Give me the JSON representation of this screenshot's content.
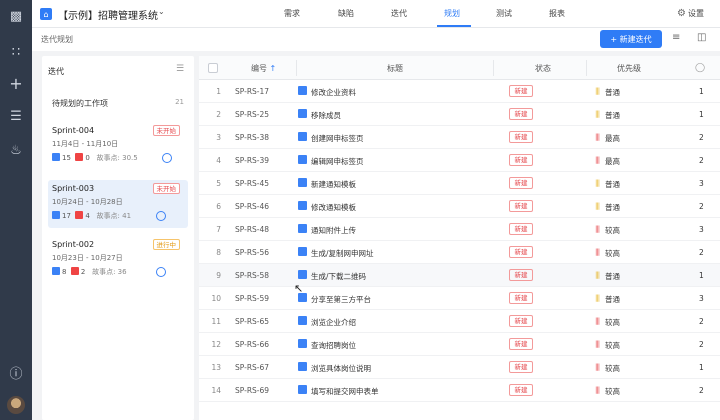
{
  "rail": {
    "icons": [
      "logo-icon",
      "apps-grid-icon",
      "plus-icon",
      "checklist-icon",
      "bell-icon",
      "help-icon"
    ]
  },
  "topbar": {
    "project": "【示例】招聘管理系统",
    "tabs": [
      "需求",
      "缺陷",
      "迭代",
      "规划",
      "测试",
      "报表"
    ],
    "active_tab": "规划",
    "settings": "设置"
  },
  "subbar": {
    "breadcrumb": "迭代规划",
    "new_button": "+ 新建迭代"
  },
  "left_panel": {
    "title": "迭代",
    "backlog": {
      "label": "待规划的工作项",
      "count": "21"
    },
    "sprints": [
      {
        "name": "Sprint-004",
        "dates": "11月4日 - 11月10日",
        "status": "未开始",
        "reqs": "15",
        "bugs": "0",
        "points": "故事点: 30.5"
      },
      {
        "name": "Sprint-003",
        "dates": "10月24日 - 10月28日",
        "status": "未开始",
        "reqs": "17",
        "bugs": "4",
        "points": "故事点: 41"
      },
      {
        "name": "Sprint-002",
        "dates": "10月23日 - 10月27日",
        "status": "进行中",
        "reqs": "8",
        "bugs": "2",
        "points": "故事点: 36"
      }
    ]
  },
  "table": {
    "headers": {
      "code": "编号",
      "title": "标题",
      "status": "状态",
      "priority": "优先级"
    },
    "rows": [
      {
        "n": "1",
        "code": "SP-RS-17",
        "title": "修改企业资料",
        "status": "新建",
        "priority": "普通",
        "pcolor": "#e6b422",
        "count": "1"
      },
      {
        "n": "2",
        "code": "SP-RS-25",
        "title": "移除成员",
        "status": "新建",
        "priority": "普通",
        "pcolor": "#e6b422",
        "count": "1"
      },
      {
        "n": "3",
        "code": "SP-RS-38",
        "title": "创建网申标签页",
        "status": "新建",
        "priority": "最高",
        "pcolor": "#e5484d",
        "count": "2"
      },
      {
        "n": "4",
        "code": "SP-RS-39",
        "title": "编辑网申标签页",
        "status": "新建",
        "priority": "最高",
        "pcolor": "#e5484d",
        "count": "2"
      },
      {
        "n": "5",
        "code": "SP-RS-45",
        "title": "新建通知模板",
        "status": "新建",
        "priority": "普通",
        "pcolor": "#e6b422",
        "count": "3"
      },
      {
        "n": "6",
        "code": "SP-RS-46",
        "title": "修改通知模板",
        "status": "新建",
        "priority": "普通",
        "pcolor": "#e6b422",
        "count": "2"
      },
      {
        "n": "7",
        "code": "SP-RS-48",
        "title": "通知附件上传",
        "status": "新建",
        "priority": "较高",
        "pcolor": "#e5484d",
        "count": "3"
      },
      {
        "n": "8",
        "code": "SP-RS-56",
        "title": "生成/复制网申网址",
        "status": "新建",
        "priority": "较高",
        "pcolor": "#e5484d",
        "count": "2"
      },
      {
        "n": "9",
        "code": "SP-RS-58",
        "title": "生成/下载二维码",
        "status": "新建",
        "priority": "普通",
        "pcolor": "#e6b422",
        "count": "1"
      },
      {
        "n": "10",
        "code": "SP-RS-59",
        "title": "分享至第三方平台",
        "status": "新建",
        "priority": "普通",
        "pcolor": "#e6b422",
        "count": "3"
      },
      {
        "n": "11",
        "code": "SP-RS-65",
        "title": "浏览企业介绍",
        "status": "新建",
        "priority": "较高",
        "pcolor": "#e5484d",
        "count": "2"
      },
      {
        "n": "12",
        "code": "SP-RS-66",
        "title": "查询招聘岗位",
        "status": "新建",
        "priority": "较高",
        "pcolor": "#e5484d",
        "count": "2"
      },
      {
        "n": "13",
        "code": "SP-RS-67",
        "title": "浏览具体岗位说明",
        "status": "新建",
        "priority": "较高",
        "pcolor": "#e5484d",
        "count": "1"
      },
      {
        "n": "14",
        "code": "SP-RS-69",
        "title": "填写和提交网申表单",
        "status": "新建",
        "priority": "较高",
        "pcolor": "#e5484d",
        "count": "2"
      }
    ]
  }
}
